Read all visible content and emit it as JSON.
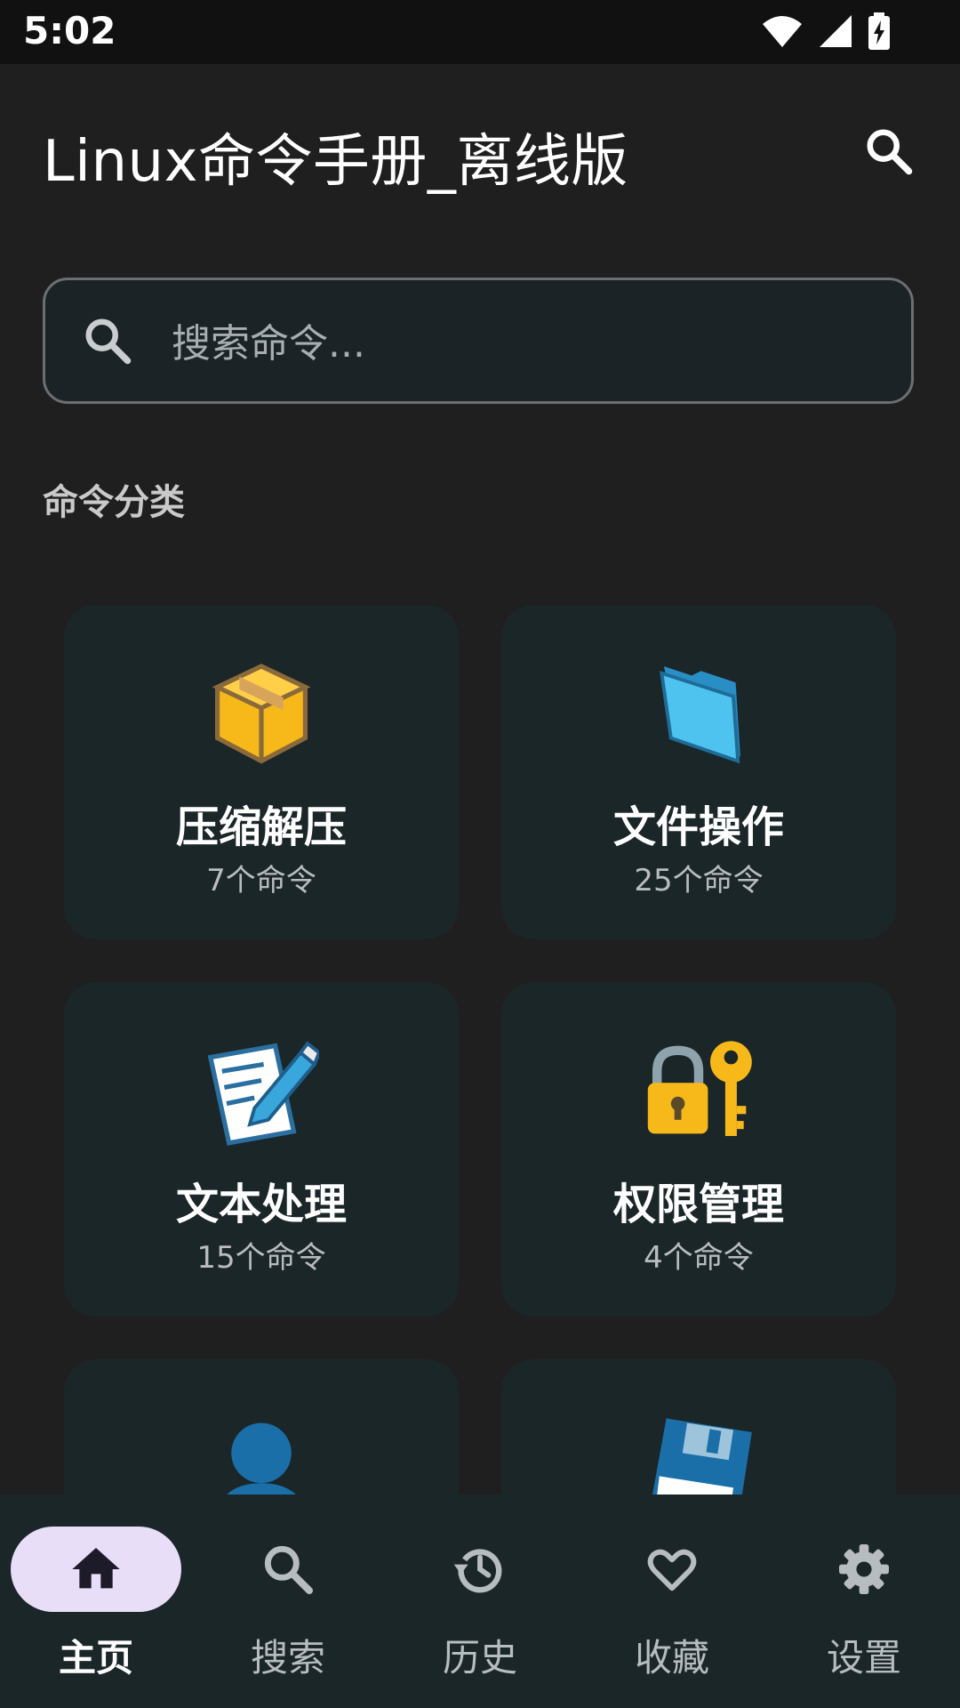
{
  "status_bar": {
    "time": "5:02"
  },
  "app_bar": {
    "title": "Linux命令手册_离线版"
  },
  "search": {
    "placeholder": "搜索命令..."
  },
  "section": {
    "title": "命令分类"
  },
  "categories": [
    {
      "name": "压缩解压",
      "count": "7个命令",
      "icon": "package-box-icon"
    },
    {
      "name": "文件操作",
      "count": "25个命令",
      "icon": "folder-icon"
    },
    {
      "name": "文本处理",
      "count": "15个命令",
      "icon": "memo-pencil-icon"
    },
    {
      "name": "权限管理",
      "count": "4个命令",
      "icon": "lock-key-icon"
    },
    {
      "name": "",
      "count": "",
      "icon": "user-silhouette-icon"
    },
    {
      "name": "",
      "count": "",
      "icon": "floppy-disk-icon"
    }
  ],
  "bottom_nav": [
    {
      "label": "主页",
      "icon": "home-icon",
      "active": true
    },
    {
      "label": "搜索",
      "icon": "search-icon",
      "active": false
    },
    {
      "label": "历史",
      "icon": "history-icon",
      "active": false
    },
    {
      "label": "收藏",
      "icon": "heart-icon",
      "active": false
    },
    {
      "label": "设置",
      "icon": "gear-icon",
      "active": false
    }
  ],
  "colors": {
    "background": "#1f1f1f",
    "card": "#1b2628",
    "nav_active_pill": "#e8def8"
  }
}
